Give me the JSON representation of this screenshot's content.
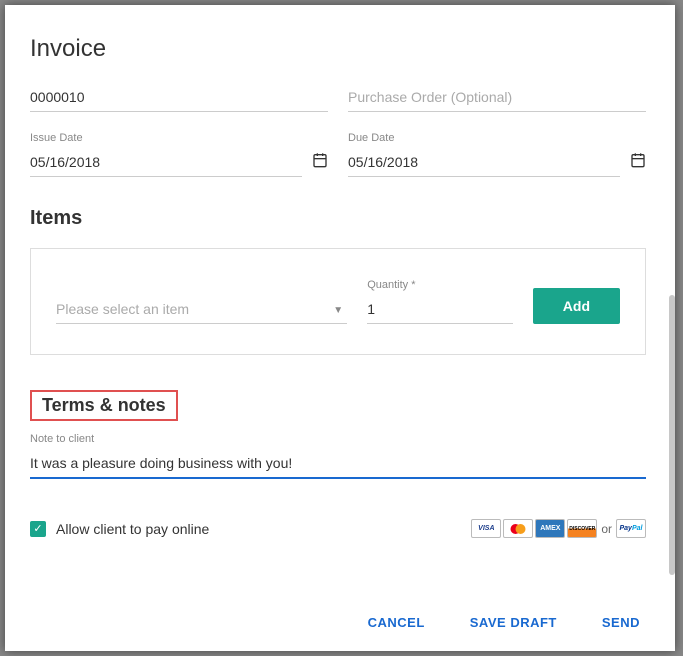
{
  "title": "Invoice",
  "invoiceNumber": "0000010",
  "purchaseOrderPlaceholder": "Purchase Order (Optional)",
  "issueDate": {
    "label": "Issue Date",
    "value": "05/16/2018"
  },
  "dueDate": {
    "label": "Due Date",
    "value": "05/16/2018"
  },
  "items": {
    "heading": "Items",
    "selectPlaceholder": "Please select an item",
    "quantityLabel": "Quantity *",
    "quantityValue": "1",
    "addLabel": "Add"
  },
  "terms": {
    "heading": "Terms & notes",
    "noteLabel": "Note to client",
    "noteValue": "It was a pleasure doing business with you!"
  },
  "allowOnline": {
    "checked": true,
    "label": "Allow client to pay online",
    "orText": "or"
  },
  "footer": {
    "cancel": "CANCEL",
    "saveDraft": "SAVE DRAFT",
    "send": "SEND"
  }
}
